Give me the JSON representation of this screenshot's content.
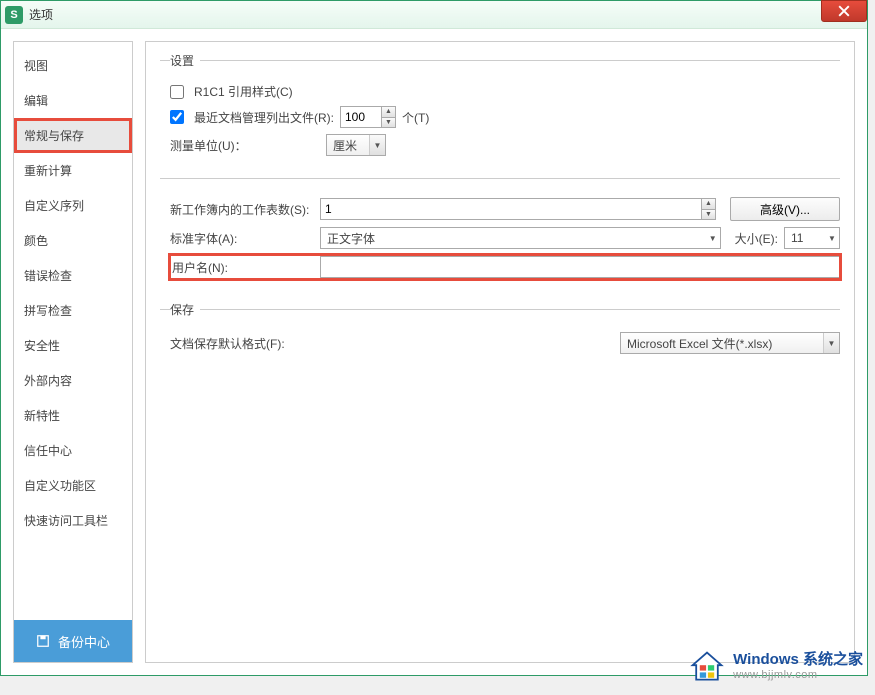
{
  "window": {
    "title": "选项",
    "icon_letter": "S"
  },
  "sidebar": {
    "items": [
      "视图",
      "编辑",
      "常规与保存",
      "重新计算",
      "自定义序列",
      "颜色",
      "错误检查",
      "拼写检查",
      "安全性",
      "外部内容",
      "新特性",
      "信任中心",
      "自定义功能区",
      "快速访问工具栏"
    ],
    "active_index": 2,
    "highlight_index": 2,
    "backup_label": "备份中心"
  },
  "settings": {
    "legend": "设置",
    "r1c1_label": "R1C1 引用样式(C)",
    "r1c1_checked": false,
    "recent_docs_label": "最近文档管理列出文件(R):",
    "recent_docs_checked": true,
    "recent_docs_value": "100",
    "recent_docs_unit": "个(T)",
    "measurement_label": "测量单位(U)：",
    "measurement_value": "厘米",
    "sheets_label": "新工作簿内的工作表数(S):",
    "sheets_value": "1",
    "advanced_btn": "高级(V)...",
    "font_label": "标准字体(A):",
    "font_value": "正文字体",
    "size_label": "大小(E):",
    "size_value": "11",
    "username_label": "用户名(N):",
    "username_value": ""
  },
  "save": {
    "legend": "保存",
    "default_format_label": "文档保存默认格式(F):",
    "default_format_value": "Microsoft Excel 文件(*.xlsx)"
  },
  "watermark": {
    "line1": "Windows 系统之家",
    "line2": "www.bjjmlv.com"
  }
}
